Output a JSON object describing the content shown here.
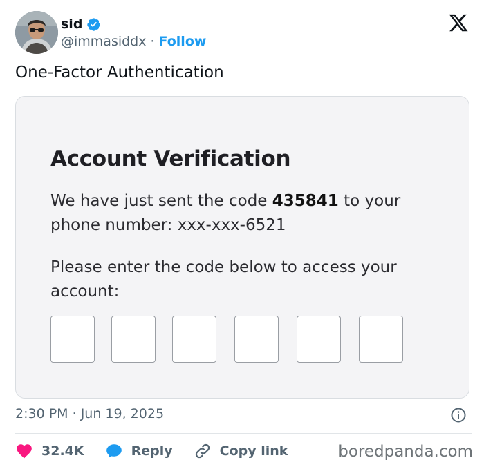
{
  "author": {
    "name": "sid",
    "handle": "@immasiddx",
    "separator": "·",
    "follow_label": "Follow"
  },
  "tweet": {
    "text": "One-Factor Authentication"
  },
  "card": {
    "title": "Account Verification",
    "para1_prefix": "We have just sent the code ",
    "code": "435841",
    "para1_suffix": " to your phone number: xxx-xxx-6521",
    "para2": "Please enter the code below to access your account:",
    "code_boxes": [
      "",
      "",
      "",
      "",
      "",
      ""
    ]
  },
  "meta": {
    "time": "2:30 PM",
    "separator": "·",
    "date": "Jun 19, 2025"
  },
  "actions": {
    "likes": "32.4K",
    "reply": "Reply",
    "copy_link": "Copy link"
  },
  "watermark": "boredpanda.com",
  "icons": {
    "verified": "verified-badge-icon",
    "brand": "x-logo-icon",
    "info": "info-icon",
    "like": "heart-icon",
    "reply": "reply-bubble-icon",
    "link": "link-icon"
  },
  "colors": {
    "accent": "#1d9bf0",
    "like": "#f91880",
    "text": "#0f1419",
    "muted": "#536471",
    "card_bg": "#f4f4f6"
  }
}
